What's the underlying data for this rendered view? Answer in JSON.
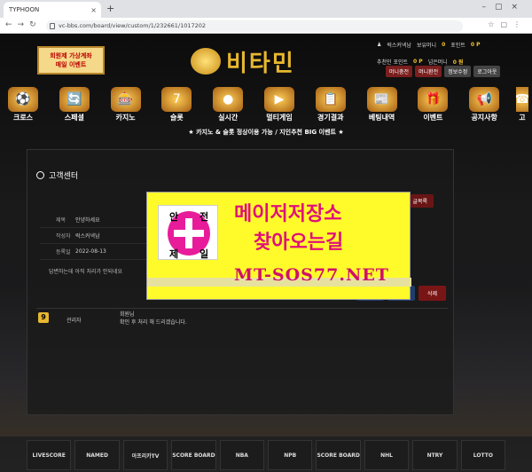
{
  "browser": {
    "tab_title": "TYPHOON",
    "url": "vc-bbs.com/board/view/custom/1/232661/1017202"
  },
  "event_banner": {
    "line1": "회원제 가상계좌",
    "line2": "매일 이벤트"
  },
  "logo_text": "비타민",
  "user": {
    "name": "럭스커넥남",
    "points_label": "포인트",
    "points": "0 P",
    "deposit_label": "보유머니",
    "deposit": "0",
    "bonus_label": "추천인 포인트",
    "bonus": "0 P",
    "cash_label": "넘은머니",
    "cash": "0 원"
  },
  "user_buttons": [
    "머니충전",
    "머니환전",
    "정보수정",
    "로그아웃"
  ],
  "menu": [
    {
      "icon": "⚽",
      "label": "크로스"
    },
    {
      "icon": "🔄",
      "label": "스페셜"
    },
    {
      "icon": "🎰",
      "label": "카지노"
    },
    {
      "icon": "7",
      "label": "슬롯"
    },
    {
      "icon": "●",
      "label": "실시간"
    },
    {
      "icon": "▶",
      "label": "멀티게임"
    },
    {
      "icon": "📋",
      "label": "경기결과"
    },
    {
      "icon": "📰",
      "label": "베팅내역"
    },
    {
      "icon": "🎁",
      "label": "이벤트"
    },
    {
      "icon": "📢",
      "label": "공지사항"
    },
    {
      "icon": "☎",
      "label": "고"
    }
  ],
  "subtitle": "★ 카지노 & 슬롯 정상이용 가능 / 지인추천 BIG 이벤트 ★",
  "panel": {
    "title": "고객센터",
    "list_button": "글목록",
    "info": [
      {
        "k": "제목",
        "v": "안녕하세요"
      },
      {
        "k": "작성자",
        "v": "럭스커넥남"
      },
      {
        "k": "등록일",
        "v": "2022-08-13"
      }
    ],
    "body": "답변하는데 아직 처리가 안되네요",
    "actions": [
      "답변",
      "수정",
      "삭제"
    ],
    "comment": {
      "name": "관리자",
      "author": "회원님",
      "text": "확인 후 처리 해 드리겠습니다."
    }
  },
  "ad": {
    "chars": [
      "안",
      "전",
      "제",
      "일"
    ],
    "line1": "메이저저장소",
    "line2": "찾아오는길",
    "url": "MT-SOS77.NET"
  },
  "footer": [
    "LIVESCORE",
    "NAMED",
    "아프리카TV",
    "SCORE BOARD",
    "NBA",
    "NPB",
    "SCORE BOARD",
    "NHL",
    "NTRY",
    "LOTTO"
  ]
}
